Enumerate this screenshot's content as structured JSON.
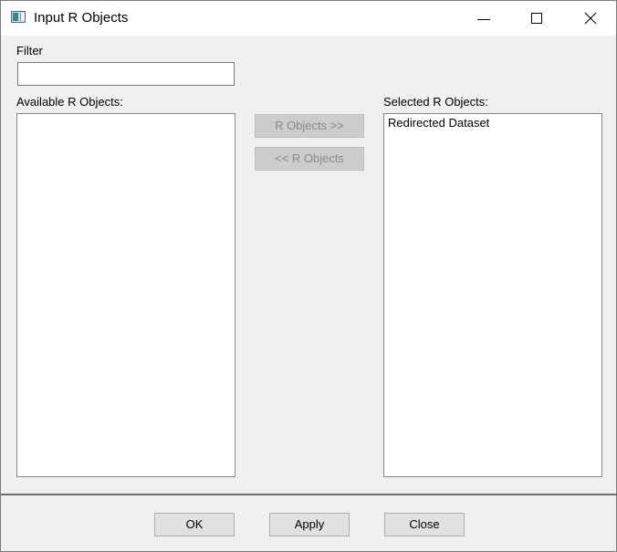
{
  "window": {
    "title": "Input R Objects"
  },
  "filter": {
    "label": "Filter",
    "value": ""
  },
  "available": {
    "label": "Available R Objects:",
    "items": []
  },
  "selected": {
    "label": "Selected R Objects:",
    "items": [
      "Redirected Dataset"
    ]
  },
  "transfer": {
    "add_label": "R Objects >>",
    "remove_label": "<< R Objects"
  },
  "footer": {
    "ok_label": "OK",
    "apply_label": "Apply",
    "close_label": "Close"
  },
  "icons": {
    "app": "app-window-icon",
    "minimize": "minimize-icon",
    "maximize": "maximize-icon",
    "close": "close-icon"
  }
}
